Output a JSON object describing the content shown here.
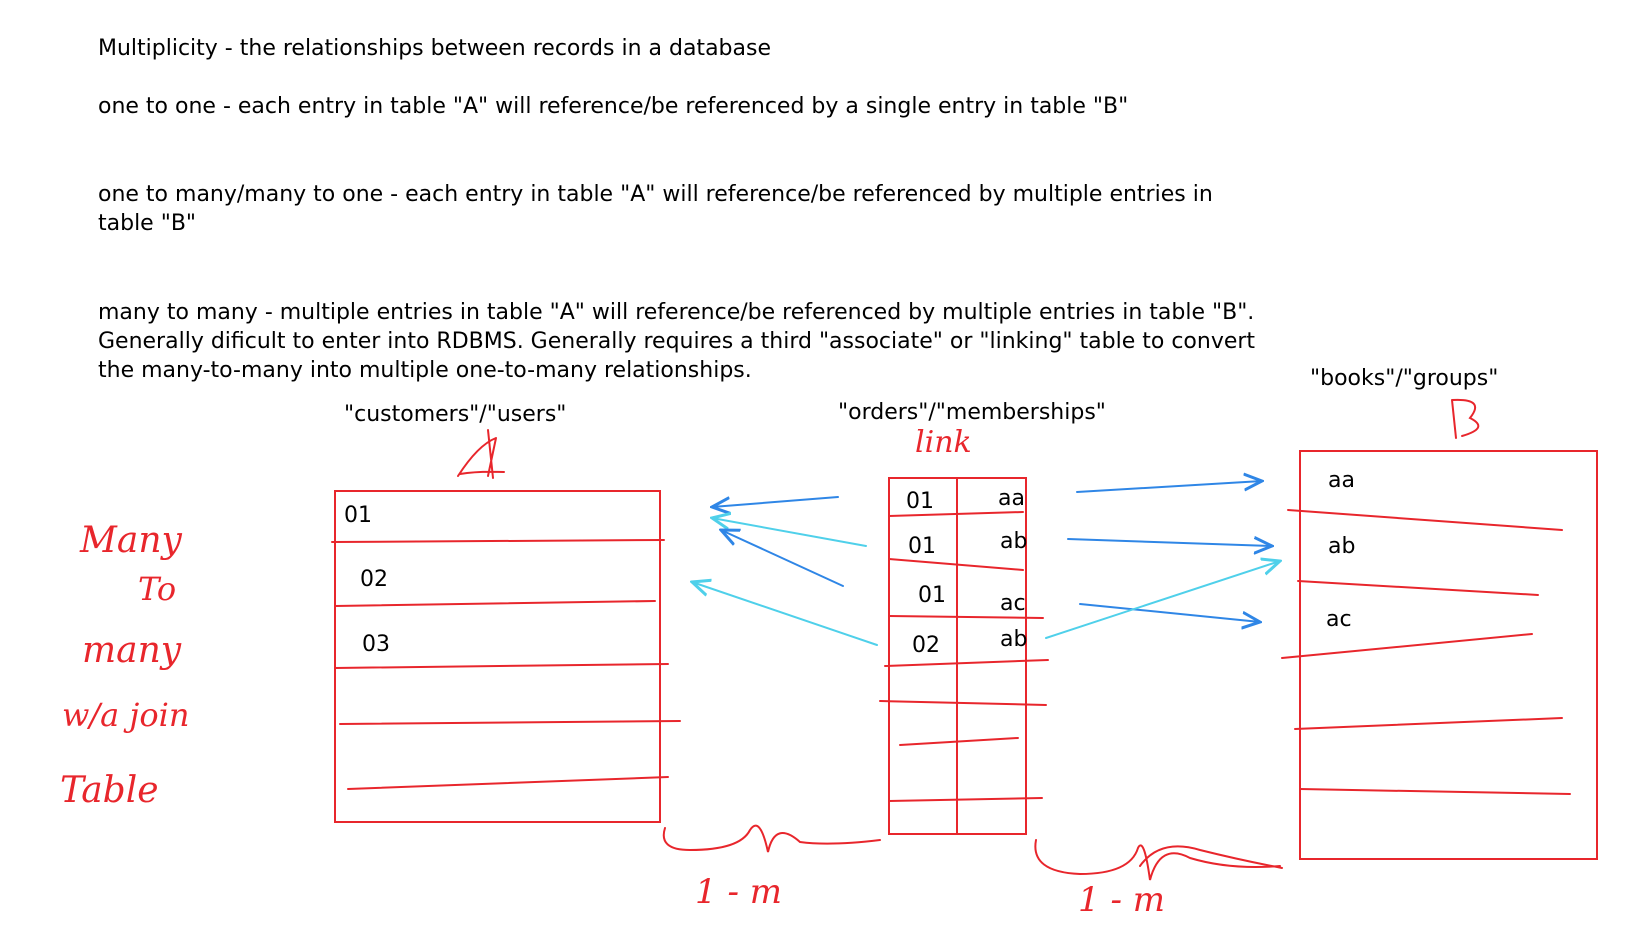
{
  "notes": {
    "title": "Multiplicity - the relationships between records in a database",
    "one_to_one": "one to one - each entry in table \"A\" will reference/be referenced by a single entry in table \"B\"",
    "one_to_many": "one to many/many to one - each entry in table \"A\" will reference/be referenced by multiple entries in table \"B\"",
    "many_to_many": "many to many - multiple entries in table \"A\" will reference/be referenced by multiple entries in table \"B\". Generally dificult to enter into RDBMS. Generally requires a third \"associate\" or \"linking\" table to convert the many-to-many into multiple one-to-many relationships."
  },
  "tables": {
    "a": {
      "label": "\"customers\"/\"users\"",
      "mark": "A",
      "rows": [
        "01",
        "02",
        "03"
      ]
    },
    "link": {
      "label": "\"orders\"/\"memberships\"",
      "mark": "link",
      "rows": [
        [
          "01",
          "aa"
        ],
        [
          "01",
          "ab"
        ],
        [
          "01",
          "ac"
        ],
        [
          "02",
          "ab"
        ]
      ]
    },
    "b": {
      "label": "\"books\"/\"groups\"",
      "mark": "B",
      "rows": [
        "aa",
        "ab",
        "ac"
      ]
    }
  },
  "handwriting": {
    "side_note": [
      "Many",
      "To",
      "many",
      "w/a join",
      "Table"
    ],
    "left_relation": "1 - m",
    "right_relation": "1 - m"
  },
  "colors": {
    "ink_red": "#e8262c",
    "arrow_blue": "#2f86e6",
    "arrow_cyan": "#4fd0ea"
  }
}
